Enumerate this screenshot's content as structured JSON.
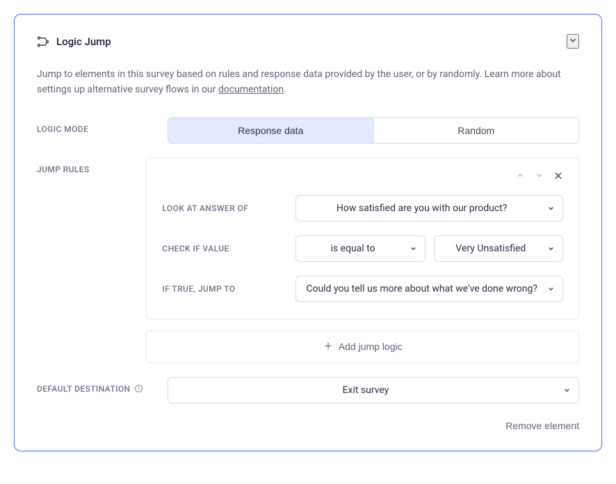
{
  "panel": {
    "title": "Logic Jump",
    "description_prefix": "Jump to elements in this survey based on rules and response data provided by the user, or by randomly. Learn more about settings up alternative survey flows in our ",
    "doc_link_text": "documentation",
    "description_suffix": "."
  },
  "labels": {
    "logic_mode": "LOGIC MODE",
    "jump_rules": "JUMP RULES",
    "default_destination": "DEFAULT DESTINATION",
    "look_at_answer": "LOOK AT ANSWER OF",
    "check_if_value": "CHECK IF VALUE",
    "if_true_jump": "IF TRUE, JUMP TO"
  },
  "segmented": {
    "response_data": "Response data",
    "random": "Random"
  },
  "rule": {
    "look_at_answer": "How satisfied are you with our product?",
    "operator": "is equal to",
    "value": "Very Unsatisfied",
    "jump_to": "Could you tell us more about what we've done wrong?"
  },
  "add_rule": "Add jump logic",
  "default_destination": "Exit survey",
  "remove_element": "Remove element"
}
